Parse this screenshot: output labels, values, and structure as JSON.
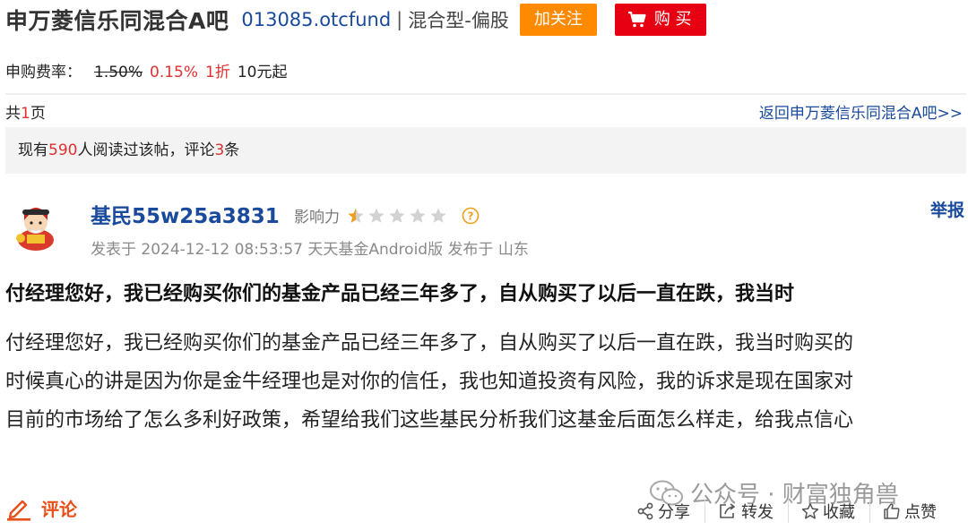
{
  "header": {
    "title": "申万菱信乐同混合A吧",
    "code": "013085.otcfund",
    "separator": "|",
    "fund_type": "混合型-偏股",
    "follow_label": "加关注",
    "buy_label": "购 买"
  },
  "fee": {
    "label": "申购费率：",
    "original": "1.50%",
    "discounted": "0.15%",
    "discount": "1折",
    "minimum": "10元起"
  },
  "pager": {
    "prefix": "共",
    "count": "1",
    "suffix": "页",
    "back_link": "返回申万菱信乐同混合A吧>>"
  },
  "stats": {
    "prefix": "现有",
    "readers": "590",
    "middle": "人阅读过该帖，评论",
    "comments": "3",
    "suffix": "条"
  },
  "post": {
    "author": "基民55w25a3831",
    "influence_label": "影响力",
    "influence_stars": 0.5,
    "influence_max": 5,
    "meta": "发表于 2024-12-12 08:53:57 天天基金Android版 发布于 山东",
    "report_label": "举报",
    "title": "付经理您好，我已经购买你们的基金产品已经三年多了，自从购买了以后一直在跌，我当时",
    "body_lines": [
      "付经理您好，我已经购买你们的基金产品已经三年多了，自从购买了以后一直在跌，我当时购买的",
      "时候真心的讲是因为你是金牛经理也是对你的信任，我也知道投资有风险，我的诉求是现在国家对",
      "目前的市场给了怎么多利好政策，希望给我们这些基民分析我们这基金后面怎么样走，给我点信心"
    ]
  },
  "footer": {
    "comment_label": "评论",
    "watermark": "公众号 · 财富独角兽",
    "share_label": "分享",
    "repost_label": "转发",
    "favorite_label": "收藏",
    "like_label": "点赞"
  },
  "colors": {
    "link_blue": "#1a4a9c",
    "accent_red": "#e03030",
    "follow_orange": "#ff8a00",
    "buy_red": "#e60012",
    "comment_orange": "#e8501a"
  }
}
